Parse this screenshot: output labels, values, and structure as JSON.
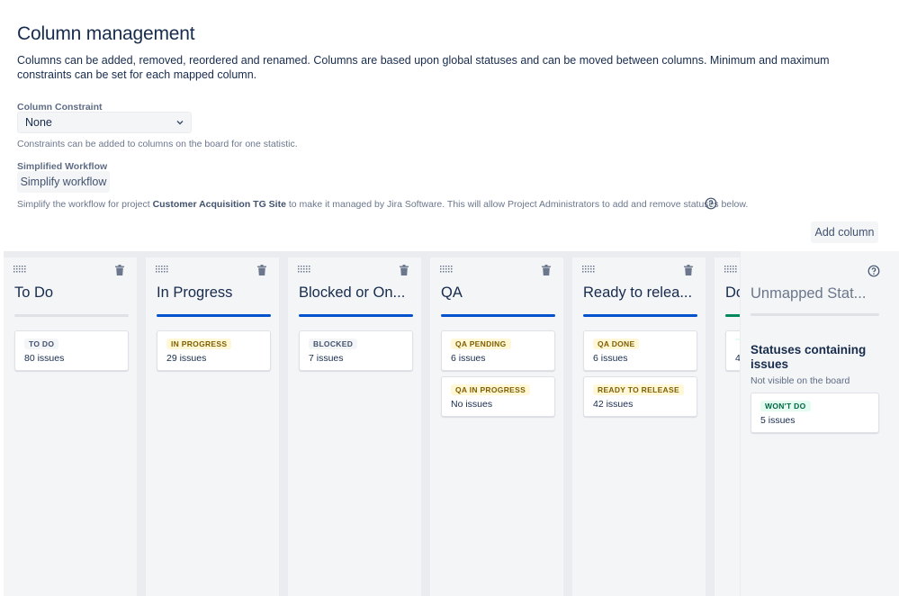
{
  "header": {
    "title": "Column management",
    "intro": "Columns can be added, removed, reordered and renamed. Columns are based upon global statuses and can be moved between columns. Minimum and maximum constraints can be set for each mapped column."
  },
  "constraint": {
    "label": "Column Constraint",
    "value": "None",
    "help": "Constraints can be added to columns on the board for one statistic."
  },
  "workflow": {
    "label": "Simplified Workflow",
    "button": "Simplify workflow",
    "help_prefix": "Simplify the workflow for project",
    "project": "Customer Acquisition TG Site",
    "help_suffix": "to make it managed by Jira Software. This will allow Project Administrators to add and remove statuses below."
  },
  "toolbar": {
    "add_column": "Add column"
  },
  "colors": {
    "blue_bar": "#0052cc",
    "green_bar": "#00875a",
    "grey_bar": "#dfe1e6",
    "todo_lozenge_bg": "#f4f5f7",
    "todo_lozenge_fg": "#42526e",
    "progress_lozenge_bg": "#fff7d6",
    "progress_lozenge_fg": "#7f5f01",
    "done_lozenge_bg": "#e3fcef",
    "done_lozenge_fg": "#006644"
  },
  "columns": [
    {
      "title": "To Do",
      "bar": "grey",
      "statuses": [
        {
          "name": "TO DO",
          "count": "80 issues",
          "kind": "todo"
        }
      ]
    },
    {
      "title": "In Progress",
      "bar": "blue",
      "statuses": [
        {
          "name": "IN PROGRESS",
          "count": "29 issues",
          "kind": "progress"
        }
      ]
    },
    {
      "title": "Blocked or On...",
      "bar": "blue",
      "statuses": [
        {
          "name": "BLOCKED",
          "count": "7 issues",
          "kind": "todo"
        }
      ]
    },
    {
      "title": "QA",
      "bar": "blue",
      "statuses": [
        {
          "name": "QA PENDING",
          "count": "6 issues",
          "kind": "progress"
        },
        {
          "name": "QA IN PROGRESS",
          "count": "No issues",
          "kind": "progress"
        }
      ]
    },
    {
      "title": "Ready to relea...",
      "bar": "blue",
      "statuses": [
        {
          "name": "QA DONE",
          "count": "6 issues",
          "kind": "progress"
        },
        {
          "name": "READY TO RELEASE",
          "count": "42 issues",
          "kind": "progress"
        }
      ]
    },
    {
      "title": "Do",
      "bar": "green",
      "statuses": [
        {
          "name": "",
          "count": "4",
          "kind": "done"
        }
      ]
    }
  ],
  "unmapped": {
    "title": "Unmapped Stat...",
    "heading": "Statuses containing issues",
    "subtext": "Not visible on the board",
    "statuses": [
      {
        "name": "WON'T DO",
        "count": "5 issues",
        "kind": "done"
      }
    ]
  },
  "icons": {
    "drag": "drag-handle-icon",
    "trash": "trash-icon",
    "help": "question-circle-icon",
    "chevron": "chevron-down-icon"
  }
}
